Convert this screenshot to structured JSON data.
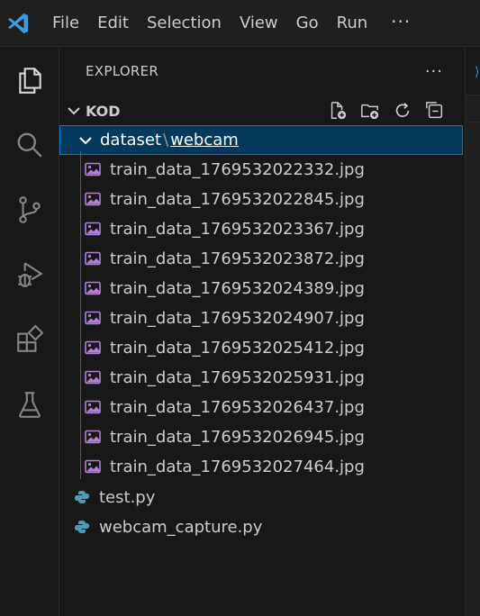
{
  "titlebar": {
    "menu": [
      "File",
      "Edit",
      "Selection",
      "View",
      "Go",
      "Run"
    ],
    "more": "···"
  },
  "activitybar": {
    "icons": [
      "explorer-icon",
      "search-icon",
      "source-control-icon",
      "run-debug-icon",
      "extensions-icon",
      "testing-icon"
    ]
  },
  "explorer": {
    "title": "EXPLORER",
    "more": "···",
    "section": "KOD",
    "folder": {
      "path": "dataset",
      "separator": "\\",
      "leaf": "webcam"
    },
    "image_files": [
      "train_data_1769532022332.jpg",
      "train_data_1769532022845.jpg",
      "train_data_1769532023367.jpg",
      "train_data_1769532023872.jpg",
      "train_data_1769532024389.jpg",
      "train_data_1769532024907.jpg",
      "train_data_1769532025412.jpg",
      "train_data_1769532025931.jpg",
      "train_data_1769532026437.jpg",
      "train_data_1769532026945.jpg",
      "train_data_1769532027464.jpg"
    ],
    "py_files": [
      "test.py",
      "webcam_capture.py"
    ]
  },
  "colors": {
    "accent": "#0078d4",
    "selection": "#04395e",
    "image_icon": "#b180d7",
    "python_icon": "#519aba"
  }
}
